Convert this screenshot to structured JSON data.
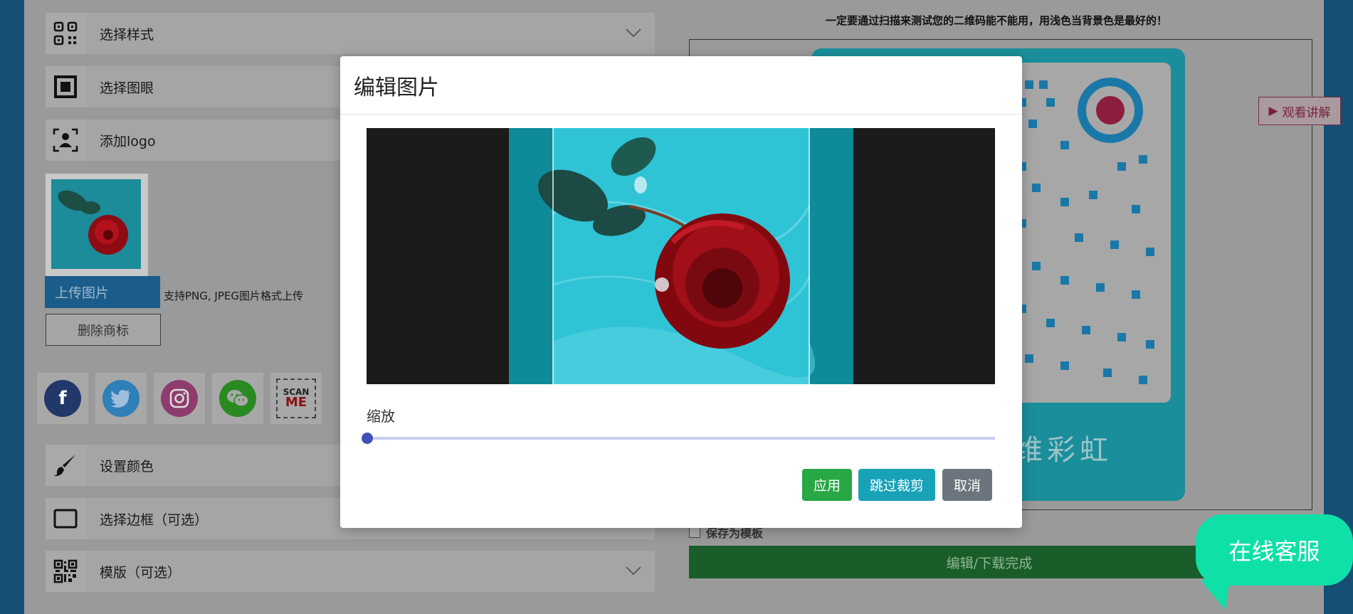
{
  "left_panel": {
    "accordion_top": [
      {
        "label": "选择样式",
        "icon": "qr-style-icon"
      },
      {
        "label": "选择图眼",
        "icon": "qr-eye-icon"
      },
      {
        "label": "添加logo",
        "icon": "user-frame-icon"
      }
    ],
    "logo": {
      "upload_label": "上传图片",
      "upload_hint": "支持PNG, JPEG图片格式上传",
      "delete_label": "删除商标"
    },
    "social_icons": [
      "facebook-icon",
      "twitter-icon",
      "instagram-icon",
      "wechat-icon",
      "scan-me-icon"
    ],
    "scan_me_text": {
      "line1": "SCAN",
      "line2": "ME"
    },
    "accordion_bottom": [
      {
        "label": "设置颜色",
        "icon": "brush-icon"
      },
      {
        "label": "选择边框（可选）",
        "icon": "frame-icon"
      },
      {
        "label": "模版（可选）",
        "icon": "qr-template-icon"
      }
    ]
  },
  "right_panel": {
    "hint": "一定要通过扫描来测试您的二维码能不能用，用浅色当背景色是最好的！",
    "watch_label": "观看讲解",
    "qr_caption": "维彩虹",
    "save_template_label": "保存为模板",
    "done_label": "编辑/下载完成"
  },
  "chat": {
    "label": "在线客服"
  },
  "modal": {
    "title": "编辑图片",
    "zoom_label": "缩放",
    "zoom_value": 0,
    "apply_label": "应用",
    "skip_label": "跳过裁剪",
    "cancel_label": "取消"
  },
  "colors": {
    "apply": "#28a745",
    "skip": "#17a2b8",
    "cancel": "#6c757d",
    "slider": "#3f51b5",
    "chat": "#0fe0a8"
  }
}
